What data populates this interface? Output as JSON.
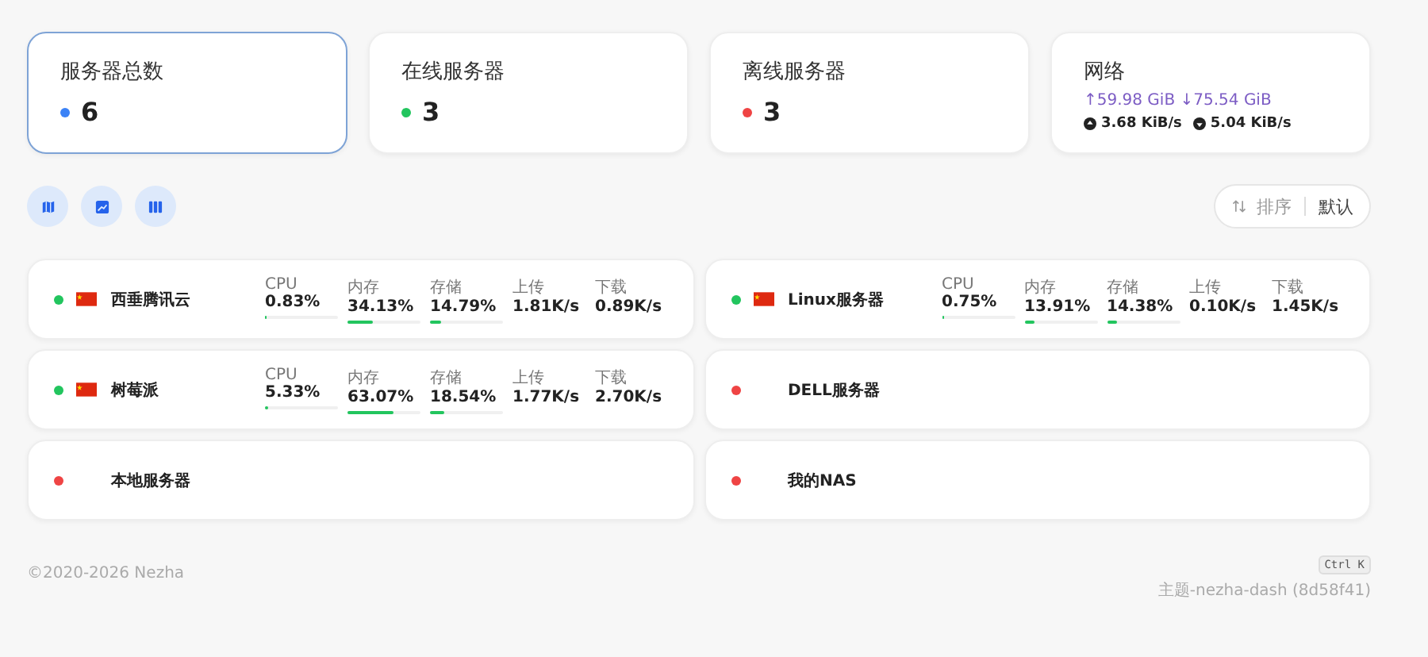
{
  "summary": [
    {
      "title": "服务器总数",
      "value": "6",
      "color": "#3b82f6",
      "selected": true
    },
    {
      "title": "在线服务器",
      "value": "3",
      "color": "#22c55e",
      "selected": false
    },
    {
      "title": "离线服务器",
      "value": "3",
      "color": "#ef4444",
      "selected": false
    }
  ],
  "network": {
    "title": "网络",
    "totals": "↑59.98 GiB ↓75.54 GiB",
    "upload_speed": "3.68 KiB/s",
    "download_speed": "5.04 KiB/s"
  },
  "sort": {
    "label": "排序",
    "value": "默认"
  },
  "servers": [
    {
      "name": "西垂腾讯云",
      "online": true,
      "flag": true,
      "metrics": [
        {
          "kind": "bar",
          "label": "CPU",
          "value": "0.83%",
          "level": 0.0083
        },
        {
          "kind": "bar",
          "label": "内存",
          "value": "34.13%",
          "level": 0.3413
        },
        {
          "kind": "bar",
          "label": "存储",
          "value": "14.79%",
          "level": 0.1479
        },
        {
          "kind": "rate",
          "label": "上传",
          "value": "1.81K/s"
        },
        {
          "kind": "rate",
          "label": "下载",
          "value": "0.89K/s"
        }
      ]
    },
    {
      "name": "Linux服务器",
      "online": true,
      "flag": true,
      "metrics": [
        {
          "kind": "bar",
          "label": "CPU",
          "value": "0.75%",
          "level": 0.0075
        },
        {
          "kind": "bar",
          "label": "内存",
          "value": "13.91%",
          "level": 0.1391
        },
        {
          "kind": "bar",
          "label": "存储",
          "value": "14.38%",
          "level": 0.1438
        },
        {
          "kind": "rate",
          "label": "上传",
          "value": "0.10K/s"
        },
        {
          "kind": "rate",
          "label": "下载",
          "value": "1.45K/s"
        }
      ]
    },
    {
      "name": "树莓派",
      "online": true,
      "flag": true,
      "metrics": [
        {
          "kind": "bar",
          "label": "CPU",
          "value": "5.33%",
          "level": 0.0533
        },
        {
          "kind": "bar",
          "label": "内存",
          "value": "63.07%",
          "level": 0.6307
        },
        {
          "kind": "bar",
          "label": "存储",
          "value": "18.54%",
          "level": 0.1854
        },
        {
          "kind": "rate",
          "label": "上传",
          "value": "1.77K/s"
        },
        {
          "kind": "rate",
          "label": "下载",
          "value": "2.70K/s"
        }
      ]
    },
    {
      "name": "DELL服务器",
      "online": false,
      "flag": false
    },
    {
      "name": "本地服务器",
      "online": false,
      "flag": false
    },
    {
      "name": "我的NAS",
      "online": false,
      "flag": false
    }
  ],
  "footer": {
    "copyright": "©2020-2026 Nezha",
    "shortcut": "Ctrl K",
    "theme": "主题-nezha-dash (8d58f41)"
  }
}
